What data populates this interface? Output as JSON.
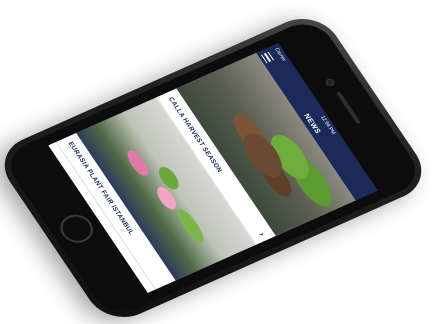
{
  "status_bar": {
    "carrier": "Carrier",
    "time": "12:58 PM",
    "battery": ""
  },
  "nav": {
    "title": "NEWS",
    "menu_icon": "hamburger-menu-icon"
  },
  "news": [
    {
      "title": "CALLA HARVEST SEASON",
      "chevron": "›"
    },
    {
      "title": "EURASIA PLANT FAIR ISTANBUL",
      "chevron": ""
    }
  ],
  "colors": {
    "brand_navy": "#1b2a59",
    "background": "#ffffff"
  }
}
